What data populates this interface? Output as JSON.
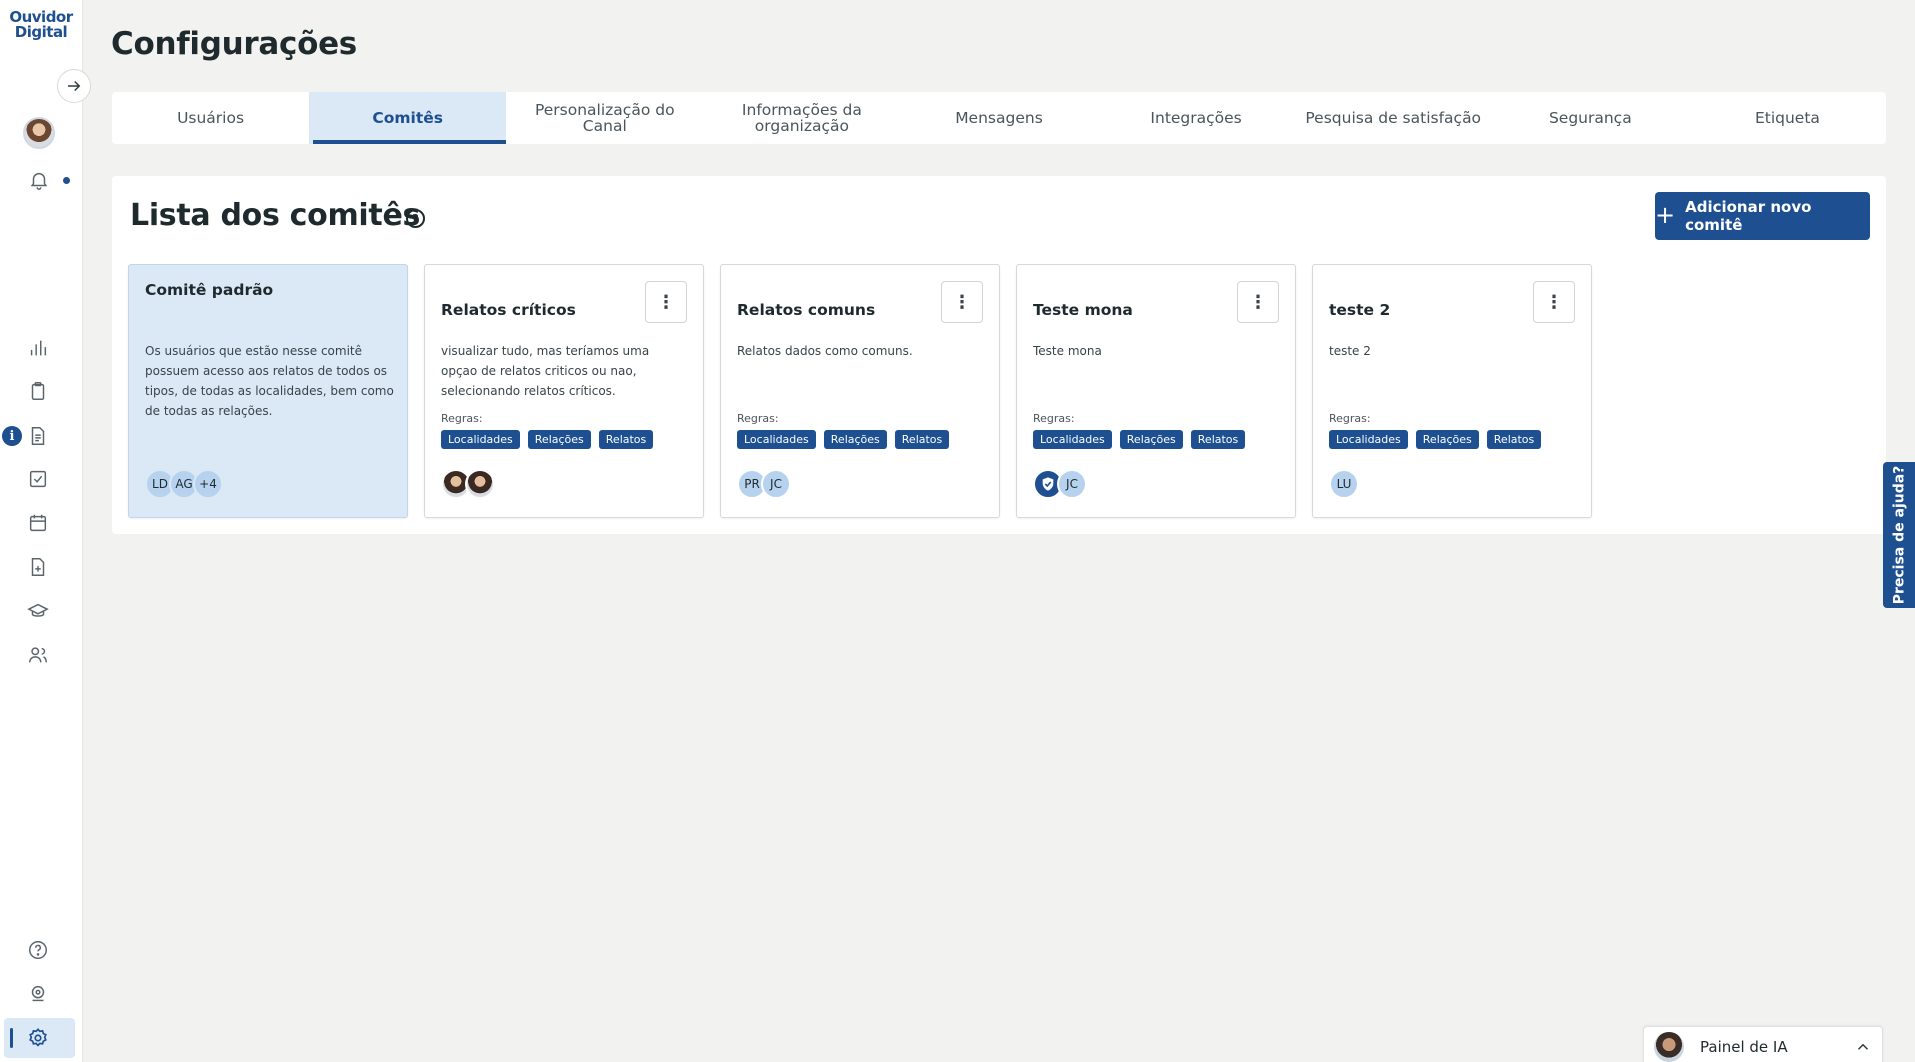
{
  "app": {
    "logo_line1": "Ouvidor",
    "logo_line2": "Digital",
    "page_title": "Configurações"
  },
  "sidebar": {
    "icons": [
      "arrow-right-icon",
      "user-avatar",
      "bell-icon",
      "bar-chart-icon",
      "clipboard-icon",
      "document-icon",
      "checkbox-icon",
      "calendar-icon",
      "file-plus-icon",
      "graduation-cap-icon",
      "users-icon",
      "help-circle-icon",
      "location-icon",
      "settings-icon"
    ],
    "info_badge": "i"
  },
  "tabs": [
    {
      "label": "Usuários"
    },
    {
      "label": "Comitês"
    },
    {
      "label": "Personalização do Canal"
    },
    {
      "label": "Informações da organização"
    },
    {
      "label": "Mensagens"
    },
    {
      "label": "Integrações"
    },
    {
      "label": "Pesquisa de satisfação"
    },
    {
      "label": "Segurança"
    },
    {
      "label": "Etiqueta"
    }
  ],
  "active_tab": "Comitês",
  "committees": {
    "title": "Lista dos comitês",
    "help": "?",
    "add_button": "Adicionar novo comitê",
    "add_icon": "+",
    "kebab_icon": "⋮",
    "rules_label": "Regras:",
    "cards": [
      {
        "title": "Comitê padrão",
        "description": "Os usuários que estão nesse comitê possuem acesso aos relatos de todos os tipos, de todas as localidades, bem como de todas as relações.",
        "avatars": [
          "LD",
          "AG",
          "+4"
        ]
      },
      {
        "title": "Relatos críticos",
        "description": "visualizar tudo, mas teríamos uma opçao de relatos criticos ou nao, selecionando relatos críticos.",
        "rules": [
          "Localidades",
          "Relações",
          "Relatos"
        ],
        "avatars": [
          "",
          ""
        ]
      },
      {
        "title": "Relatos comuns",
        "description": "Relatos dados como comuns.",
        "rules": [
          "Localidades",
          "Relações",
          "Relatos"
        ],
        "avatars": [
          "PR",
          "JC"
        ]
      },
      {
        "title": "Teste mona",
        "description": "Teste mona",
        "rules": [
          "Localidades",
          "Relações",
          "Relatos"
        ],
        "avatars": [
          "",
          "JC"
        ]
      },
      {
        "title": "teste 2",
        "description": "teste 2",
        "rules": [
          "Localidades",
          "Relações",
          "Relatos"
        ],
        "avatars": [
          "LU"
        ]
      }
    ]
  },
  "help_tab": "Precisa de ajuda?",
  "ai_panel": {
    "label": "Painel de IA"
  },
  "colors": {
    "brand": "#1d4f91",
    "active_tab_bg": "#dbe9f7",
    "page_bg": "#f2f2f0"
  }
}
